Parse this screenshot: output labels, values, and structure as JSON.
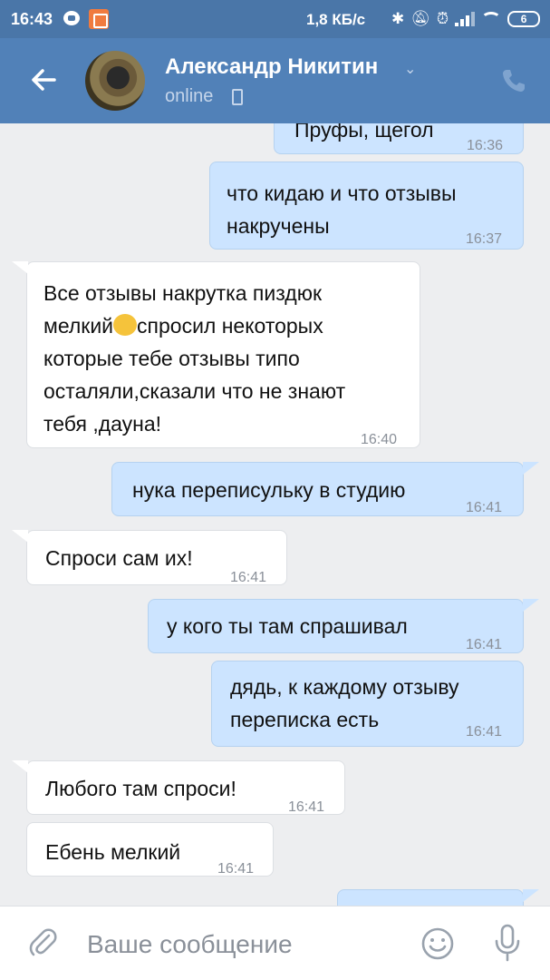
{
  "status_bar": {
    "time": "16:43",
    "speed": "1,8 КБ/с",
    "battery": "6",
    "icons": [
      "message-icon",
      "app-notification-icon",
      "bluetooth-icon",
      "mute-icon",
      "alarm-icon",
      "signal-icon",
      "wifi-icon",
      "battery-icon"
    ]
  },
  "header": {
    "contact_name": "Александр Никитин",
    "status": "online",
    "accent_color": "#5181b8"
  },
  "messages": [
    {
      "direction": "out",
      "text": "Пруфы, щегол",
      "time": "16:36"
    },
    {
      "direction": "out",
      "text": "что кидаю и что отзывы накручены",
      "time": "16:37"
    },
    {
      "direction": "in",
      "text_lines": [
        "Все отзывы накрутка пиздюк",
        "мелкий",
        "спросил некоторых",
        "которые тебе отзывы типо",
        "осталяли,сказали что не знают",
        "тебя ,дауна!"
      ],
      "time": "16:40"
    },
    {
      "direction": "out",
      "text": "нука переписульку в студию",
      "time": "16:41"
    },
    {
      "direction": "in",
      "text": "Спроси сам их!",
      "time": "16:41"
    },
    {
      "direction": "out",
      "text": "у кого ты там спрашивал",
      "time": "16:41"
    },
    {
      "direction": "out",
      "text_lines": [
        "дядь, к каждому отзыву",
        "переписка есть"
      ],
      "time": "16:41"
    },
    {
      "direction": "in",
      "text": "Любого там спроси!",
      "time": "16:41"
    },
    {
      "direction": "in",
      "text": "Ебень мелкий",
      "time": "16:41"
    }
  ],
  "input": {
    "placeholder": "Ваше сообщение"
  }
}
